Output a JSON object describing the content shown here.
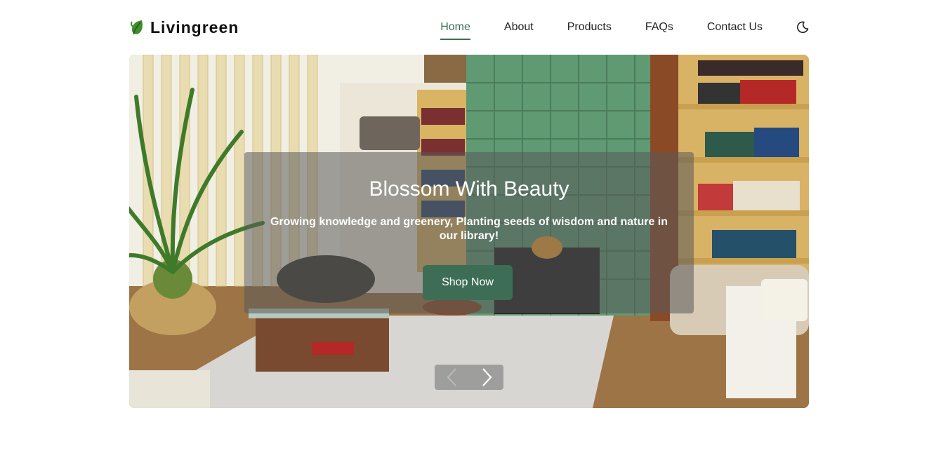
{
  "brand": {
    "name": "Livingreen",
    "logo_icon": "leaf-icon"
  },
  "nav": {
    "items": [
      {
        "label": "Home",
        "active": true
      },
      {
        "label": "About",
        "active": false
      },
      {
        "label": "Products",
        "active": false
      },
      {
        "label": "FAQs",
        "active": false
      },
      {
        "label": "Contact Us",
        "active": false
      }
    ],
    "theme_icon": "moon-icon"
  },
  "hero": {
    "title": "Blossom With Beauty",
    "subtitle": "Growing knowledge and greenery, Planting seeds of wisdom and nature in our library!",
    "cta_label": "Shop Now",
    "prev_icon": "chevron-left-icon",
    "next_icon": "chevron-right-icon"
  },
  "colors": {
    "accent": "#3d6e55",
    "overlay": "#5a5a5a"
  }
}
